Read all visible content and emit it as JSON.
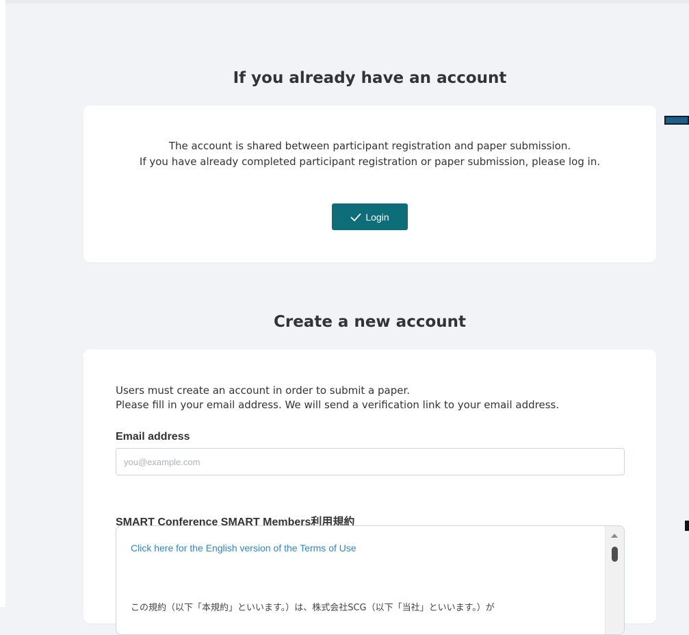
{
  "login_section": {
    "title": "If you already have an account",
    "message_line1": "The account is shared between participant registration and paper submission.",
    "message_line2": "If you have already completed participant registration or paper submission, please log in.",
    "login_button": {
      "label": "Login",
      "icon": "check-icon"
    }
  },
  "create_section": {
    "title": "Create a new account",
    "intro_line1": "Users must create an account in order to submit a paper.",
    "intro_line2": "Please fill in your email address. We will send a verification link to your email address.",
    "email": {
      "label": "Email address",
      "placeholder": "you@example.com",
      "value": ""
    },
    "terms": {
      "label": "SMART Conference SMART Members利用規約",
      "english_link": "Click here for the English version of the Terms of Use",
      "body_preview": "この規約（以下「本規約」といいます。）は、株式会社SCG（以下「当社」といいます。）が"
    }
  },
  "colors": {
    "accent": "#0d6e79",
    "link": "#2d86c9",
    "page_background": "#f2f3f6",
    "card_background": "#ffffff"
  }
}
